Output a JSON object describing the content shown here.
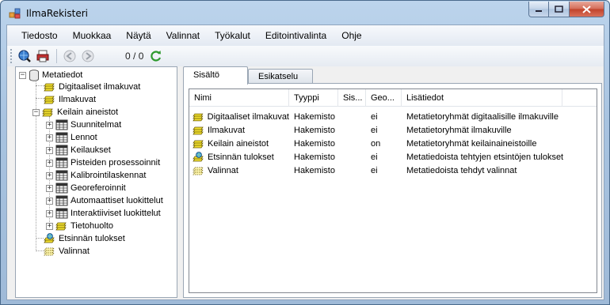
{
  "window": {
    "title": "IlmaRekisteri"
  },
  "menu": [
    "Tiedosto",
    "Muokkaa",
    "Näytä",
    "Valinnat",
    "Työkalut",
    "Editointivalinta",
    "Ohje"
  ],
  "toolbar": {
    "page_current": "0",
    "page_sep": "/",
    "page_total": "0"
  },
  "tree": {
    "root": "Metatiedot",
    "items": [
      {
        "label": "Digitaaliset ilmakuvat",
        "icon": "folder-icon"
      },
      {
        "label": "Ilmakuvat",
        "icon": "folder-icon"
      },
      {
        "label": "Keilain aineistot",
        "icon": "folder-icon",
        "expanded": true,
        "children": [
          {
            "label": "Suunnitelmat",
            "icon": "table-icon"
          },
          {
            "label": "Lennot",
            "icon": "table-icon"
          },
          {
            "label": "Keilaukset",
            "icon": "table-icon"
          },
          {
            "label": "Pisteiden prosessoinnit",
            "icon": "table-icon"
          },
          {
            "label": "Kalibrointilaskennat",
            "icon": "table-icon"
          },
          {
            "label": "Georeferoinnit",
            "icon": "table-icon"
          },
          {
            "label": "Automaattiset luokittelut",
            "icon": "table-icon"
          },
          {
            "label": "Interaktiiviset luokittelut",
            "icon": "table-icon"
          },
          {
            "label": "Tietohuolto",
            "icon": "folder-icon"
          }
        ]
      },
      {
        "label": "Etsinnän tulokset",
        "icon": "search-results-icon"
      },
      {
        "label": "Valinnat",
        "icon": "selection-folder-icon"
      }
    ]
  },
  "tabs": [
    "Sisältö",
    "Esikatselu"
  ],
  "list": {
    "columns": [
      "Nimi",
      "Tyyppi",
      "Sis...",
      "Geo...",
      "Lisätiedot"
    ],
    "rows": [
      {
        "icon": "folder-icon",
        "name": "Digitaaliset ilmakuvat",
        "type": "Hakemisto",
        "sis": "",
        "geo": "ei",
        "info": "Metatietoryhmät digitaalisille ilmakuville"
      },
      {
        "icon": "folder-icon",
        "name": "Ilmakuvat",
        "type": "Hakemisto",
        "sis": "",
        "geo": "ei",
        "info": "Metatietoryhmät ilmakuville"
      },
      {
        "icon": "folder-icon",
        "name": "Keilain aineistot",
        "type": "Hakemisto",
        "sis": "",
        "geo": "on",
        "info": "Metatietoryhmät keilainaineistoille"
      },
      {
        "icon": "search-results-icon",
        "name": "Etsinnän tulokset",
        "type": "Hakemisto",
        "sis": "",
        "geo": "ei",
        "info": "Metatiedoista tehtyjen etsintöjen tulokset"
      },
      {
        "icon": "selection-folder-icon",
        "name": "Valinnat",
        "type": "Hakemisto",
        "sis": "",
        "geo": "ei",
        "info": "Metatiedoista tehdyt valinnat"
      }
    ]
  }
}
